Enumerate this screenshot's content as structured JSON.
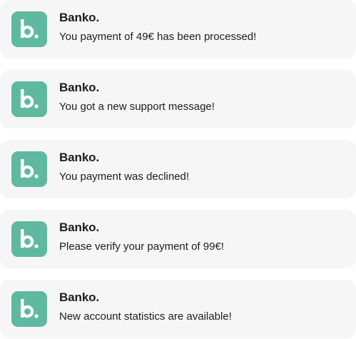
{
  "brand": {
    "icon": "banko-b-logo-icon",
    "icon_bg": "#5fb9a0",
    "icon_fg": "#ffffff",
    "logo_letter": "b."
  },
  "notifications": [
    {
      "app_name": "Banko.",
      "message": "You payment of 49€ has been processed!"
    },
    {
      "app_name": "Banko.",
      "message": "You got a new support message!"
    },
    {
      "app_name": "Banko.",
      "message": "You payment was declined!"
    },
    {
      "app_name": "Banko.",
      "message": "Please verify your payment of 99€!"
    },
    {
      "app_name": "Banko.",
      "message": "New account statistics are available!"
    }
  ]
}
